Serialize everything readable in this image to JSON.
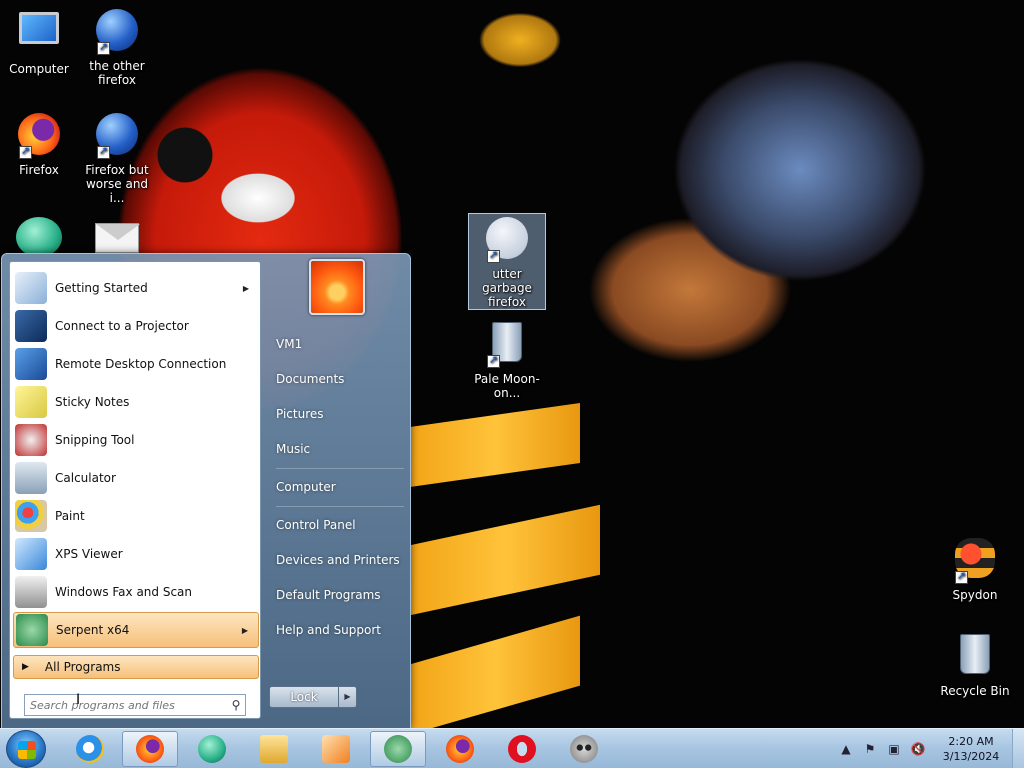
{
  "desktop": {
    "icons": [
      {
        "label": "Computer",
        "icon": "computer-icon"
      },
      {
        "label": "the other firefox",
        "icon": "globe-icon"
      },
      {
        "label": "Firefox",
        "icon": "firefox-icon"
      },
      {
        "label": "Firefox but worse and i...",
        "icon": "globe-icon"
      },
      {
        "label": "utter garbage firefox",
        "icon": "pale-moon-icon"
      },
      {
        "label": "Pale Moon-on...",
        "icon": "recycle-bin-icon"
      },
      {
        "label": "Spydon",
        "icon": "spydon-icon"
      },
      {
        "label": "Recycle Bin",
        "icon": "recycle-bin-icon"
      }
    ]
  },
  "start_menu": {
    "programs": [
      {
        "label": "Getting Started",
        "icon": "getting-started-icon",
        "has_submenu": true
      },
      {
        "label": "Connect to a Projector",
        "icon": "projector-icon",
        "has_submenu": false
      },
      {
        "label": "Remote Desktop Connection",
        "icon": "remote-desktop-icon",
        "has_submenu": false
      },
      {
        "label": "Sticky Notes",
        "icon": "sticky-notes-icon",
        "has_submenu": false
      },
      {
        "label": "Snipping Tool",
        "icon": "snipping-tool-icon",
        "has_submenu": false
      },
      {
        "label": "Calculator",
        "icon": "calculator-icon",
        "has_submenu": false
      },
      {
        "label": "Paint",
        "icon": "paint-icon",
        "has_submenu": false
      },
      {
        "label": "XPS Viewer",
        "icon": "xps-viewer-icon",
        "has_submenu": false
      },
      {
        "label": "Windows Fax and Scan",
        "icon": "fax-scan-icon",
        "has_submenu": false
      },
      {
        "label": "Serpent x64",
        "icon": "serpent-icon",
        "has_submenu": true
      }
    ],
    "all_programs": "All Programs",
    "search_placeholder": "Search programs and files",
    "right_links": [
      "VM1",
      "Documents",
      "Pictures",
      "Music",
      "Computer",
      "Control Panel",
      "Devices and Printers",
      "Default Programs",
      "Help and Support"
    ],
    "lock_label": "Lock"
  },
  "taskbar": {
    "pinned": [
      "internet-explorer-icon",
      "firefox-icon",
      "teal-browser-icon",
      "file-explorer-icon",
      "media-player-icon",
      "serpent-icon",
      "firefox-icon",
      "opera-icon",
      "raccoon-icon"
    ],
    "clock_time": "2:20 AM",
    "clock_date": "3/13/2024"
  },
  "colors": {
    "highlight": "#f6c07a",
    "taskbar": "#a9c6e2",
    "start_menu": "#6a8aa8"
  }
}
